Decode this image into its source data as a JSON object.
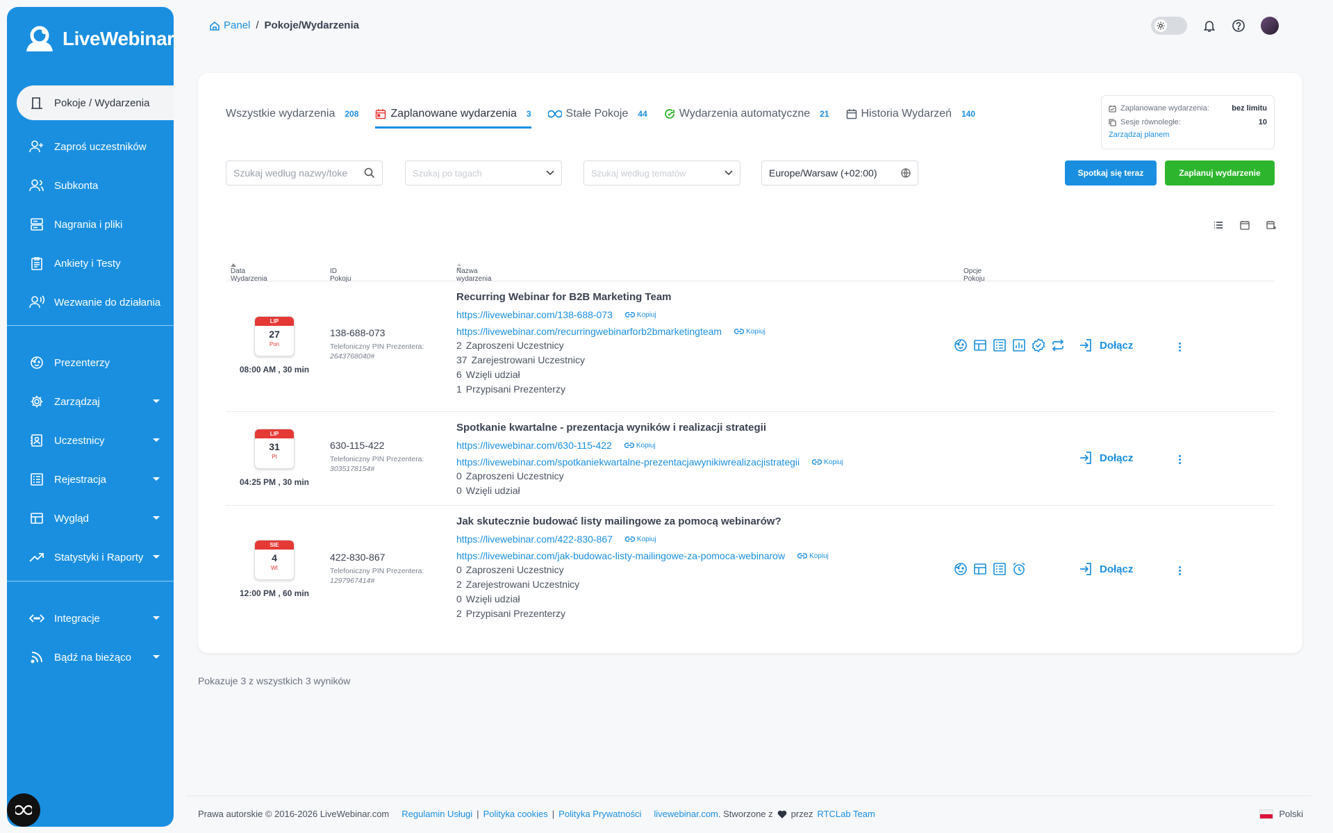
{
  "brand": {
    "name": "LiveWebinar"
  },
  "sidebar": {
    "items": [
      {
        "label": "Pokoje / Wydarzenia",
        "icon": "door-icon"
      },
      {
        "label": "Zaproś uczestników",
        "icon": "user-plus-icon"
      },
      {
        "label": "Subkonta",
        "icon": "users-icon"
      },
      {
        "label": "Nagrania i pliki",
        "icon": "server-icon"
      },
      {
        "label": "Ankiety i Testy",
        "icon": "clipboard-icon"
      },
      {
        "label": "Wezwanie do działania",
        "icon": "user-voice-icon"
      },
      {
        "label": "Prezenterzy",
        "icon": "face-icon"
      },
      {
        "label": "Zarządzaj",
        "icon": "gear-icon"
      },
      {
        "label": "Uczestnicy",
        "icon": "contact-icon"
      },
      {
        "label": "Rejestracja",
        "icon": "list-icon"
      },
      {
        "label": "Wygląd",
        "icon": "layout-icon"
      },
      {
        "label": "Statystyki i Raporty",
        "icon": "trend-icon"
      },
      {
        "label": "Integracje",
        "icon": "code-icon"
      },
      {
        "label": "Bądź na bieżąco",
        "icon": "rss-icon"
      }
    ]
  },
  "breadcrumb": {
    "home": "Panel",
    "separator": "/",
    "current": "Pokoje/Wydarzenia"
  },
  "tabs": [
    {
      "label": "Wszystkie wydarzenia",
      "count": "208"
    },
    {
      "label": "Zaplanowane wydarzenia",
      "count": "3"
    },
    {
      "label": "Stałe Pokoje",
      "count": "44"
    },
    {
      "label": "Wydarzenia automatyczne",
      "count": "21"
    },
    {
      "label": "Historia Wydarzeń",
      "count": "140"
    }
  ],
  "plan": {
    "scheduled_label": "Zaplanowane wydarzenia:",
    "scheduled_value": "bez limitu",
    "sessions_label": "Sesje równoległe:",
    "sessions_value": "10",
    "manage_link": "Zarządzaj planem"
  },
  "filters": {
    "search_placeholder": "Szukaj według nazwy/toke",
    "tags_placeholder": "Szukaj po tagach",
    "topics_placeholder": "Szukaj według tematów",
    "timezone": "Europe/Warsaw (+02:00)"
  },
  "buttons": {
    "meet_now": "Spotkaj się teraz",
    "schedule": "Zaplanuj wydarzenie"
  },
  "colors": {
    "primary": "#1a8fe0",
    "success": "#2db52d",
    "danger": "#e53935"
  },
  "table": {
    "headers": {
      "date": "Data Wydarzenia",
      "room_id": "ID Pokoju",
      "name": "Nazwa wydarzenia",
      "options": "Opcje Pokoju"
    },
    "pin_label": "Telefoniczny PIN Prezentera:",
    "copy_label": "Kopiuj",
    "join_label": "Dołącz",
    "rows": [
      {
        "month": "LIP",
        "day": "27",
        "weekday": "Pon",
        "time": "08:00 AM , 30 min",
        "room_id": "138-688-073",
        "pin": "2643768040#",
        "title": "Recurring Webinar for B2B Marketing Team",
        "link1": "https://livewebinar.com/138-688-073",
        "link2": "https://livewebinar.com/recurringwebinarforb2bmarketingteam",
        "stats": [
          {
            "n": "2",
            "label": "Zaproszeni Uczestnicy"
          },
          {
            "n": "37",
            "label": "Zarejestrowani Uczestnicy"
          },
          {
            "n": "6",
            "label": "Wzięli udział"
          },
          {
            "n": "1",
            "label": "Przypisani Prezenterzy"
          }
        ],
        "options": [
          "presenter-icon",
          "layout-icon",
          "registration-icon",
          "stats-icon",
          "verified-icon",
          "repeat-icon"
        ]
      },
      {
        "month": "LIP",
        "day": "31",
        "weekday": "Pt",
        "time": "04:25 PM , 30 min",
        "room_id": "630-115-422",
        "pin": "3035178154#",
        "title": "Spotkanie kwartalne - prezentacja wyników i realizacji strategii",
        "link1": "https://livewebinar.com/630-115-422",
        "link2": "https://livewebinar.com/spotkaniekwartalne-prezentacjawynikiwrealizacjistrategii",
        "stats": [
          {
            "n": "0",
            "label": "Zaproszeni Uczestnicy"
          },
          {
            "n": "0",
            "label": "Wzięli udział"
          }
        ],
        "options": []
      },
      {
        "month": "SIE",
        "day": "4",
        "weekday": "Wt",
        "time": "12:00 PM , 60 min",
        "room_id": "422-830-867",
        "pin": "1297967414#",
        "title": "Jak skutecznie budować listy mailingowe za pomocą webinarów?",
        "link1": "https://livewebinar.com/422-830-867",
        "link2": "https://livewebinar.com/jak-budowac-listy-mailingowe-za-pomoca-webinarow",
        "stats": [
          {
            "n": "0",
            "label": "Zaproszeni Uczestnicy"
          },
          {
            "n": "2",
            "label": "Zarejestrowani Uczestnicy"
          },
          {
            "n": "0",
            "label": "Wzięli udział"
          },
          {
            "n": "2",
            "label": "Przypisani Prezenterzy"
          }
        ],
        "options": [
          "presenter-icon",
          "layout-icon",
          "registration-icon",
          "alarm-icon"
        ]
      }
    ]
  },
  "results_text": "Pokazuje 3 z wszystkich 3 wyników",
  "footer": {
    "copyright": "Prawa autorskie © 2016-2026 LiveWebinar.com",
    "terms": "Regulamin Usługi",
    "cookies": "Polityka cookies",
    "privacy": "Polityka Prywatności",
    "site": "livewebinar.com",
    "made_prefix": ". Stworzone z",
    "made_by": "przez",
    "team": "RTCLab Team",
    "pipe": "|",
    "language": "Polski"
  }
}
